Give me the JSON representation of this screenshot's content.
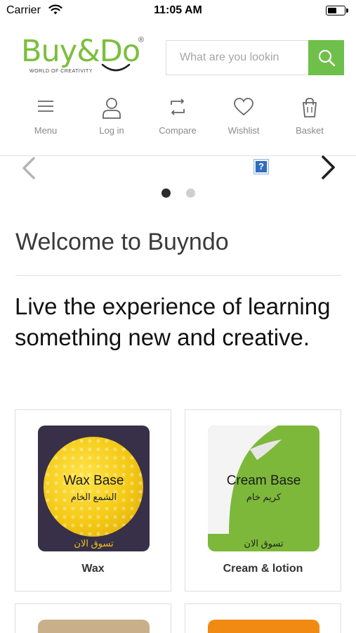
{
  "status_bar": {
    "carrier": "Carrier",
    "time": "11:05 AM",
    "battery_level": 0.55
  },
  "header": {
    "logo_text": "Buy&Do",
    "logo_registered": "®",
    "logo_tagline": "WORLD OF CREATIVITY",
    "search": {
      "placeholder": "What are you lookin",
      "value": ""
    },
    "search_icon": "search-icon"
  },
  "nav": [
    {
      "label": "Menu",
      "icon": "hamburger-icon"
    },
    {
      "label": "Log in",
      "icon": "user-icon"
    },
    {
      "label": "Compare",
      "icon": "compare-icon"
    },
    {
      "label": "Wishlist",
      "icon": "heart-icon"
    },
    {
      "label": "Basket",
      "icon": "shopping-bag-icon"
    }
  ],
  "slider": {
    "help_badge": "?",
    "dot_count": 2,
    "active_dot": 1
  },
  "content": {
    "welcome": "Welcome to Buyndo",
    "tagline": "Live the experience of learning something new and creative."
  },
  "products": [
    {
      "label": "Wax",
      "image_title": "Wax Base",
      "image_subtitle": "الشمع الخام",
      "image_cta": "تسوق الان"
    },
    {
      "label": "Cream & lotion",
      "image_title": "Cream Base",
      "image_subtitle": "كريم خام",
      "image_cta": "تسوق الان"
    }
  ],
  "colors": {
    "brand_green": "#7bbf3d",
    "search_button": "#6fbf4b",
    "wax_card_bg": "#383048",
    "cream_card_bg": "#7db83a"
  }
}
